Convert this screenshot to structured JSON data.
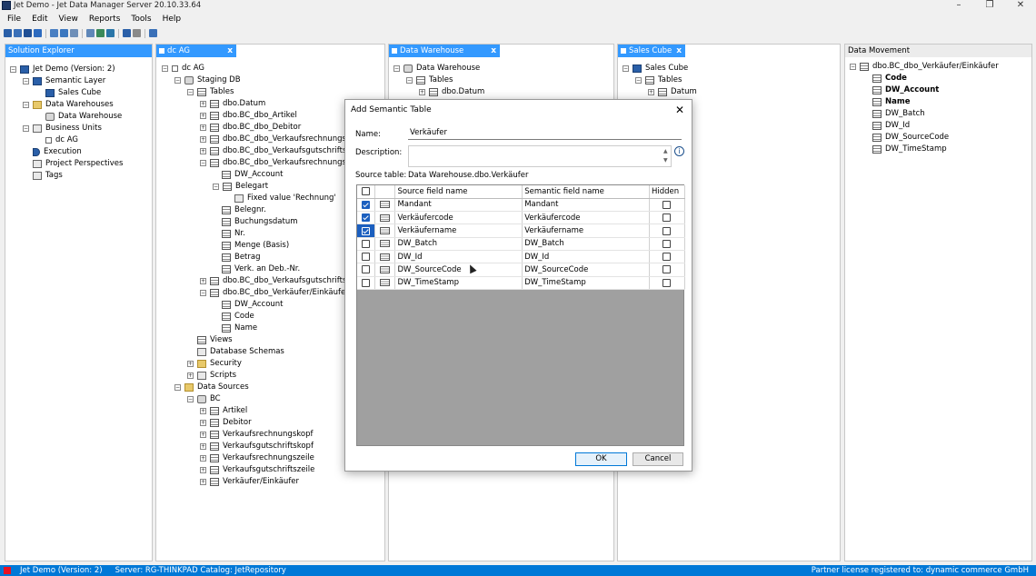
{
  "window": {
    "title": "Jet Demo - Jet Data Manager Server 20.10.33.64",
    "controls": [
      "–",
      "❐",
      "✕"
    ]
  },
  "menu": [
    "File",
    "Edit",
    "View",
    "Reports",
    "Tools",
    "Help"
  ],
  "panels": {
    "solution_explorer": {
      "title": "Solution Explorer",
      "items": [
        {
          "label": "Jet Demo (Version: 2)",
          "icon": "project-icon"
        },
        {
          "label": "Semantic Layer",
          "icon": "semantic-icon"
        },
        {
          "label": "Sales Cube",
          "icon": "cube-icon"
        },
        {
          "label": "Data Warehouses",
          "icon": "folder-icon"
        },
        {
          "label": "Data Warehouse",
          "icon": "warehouse-icon"
        },
        {
          "label": "Business Units",
          "icon": "business-icon"
        },
        {
          "label": "dc AG",
          "icon": "unit-icon"
        },
        {
          "label": "Execution",
          "icon": "execution-icon"
        },
        {
          "label": "Project Perspectives",
          "icon": "perspective-icon"
        },
        {
          "label": "Tags",
          "icon": "tag-icon"
        }
      ]
    },
    "dc_ag": {
      "title": "dc AG",
      "items": [
        "dc AG",
        "Staging DB",
        "Tables",
        "dbo.Datum",
        "dbo.BC_dbo_Artikel",
        "dbo.BC_dbo_Debitor",
        "dbo.BC_dbo_Verkaufsrechnungskopf",
        "dbo.BC_dbo_Verkaufsgutschriftskopf",
        "dbo.BC_dbo_Verkaufsrechnungszeile",
        "DW_Account",
        "Belegart",
        "Fixed value 'Rechnung'",
        "Belegnr.",
        "Buchungsdatum",
        "Nr.",
        "Menge (Basis)",
        "Betrag",
        "Verk. an Deb.-Nr.",
        "dbo.BC_dbo_Verkaufsgutschriftszeile",
        "dbo.BC_dbo_Verkäufer/Einkäufer*",
        "DW_Account",
        "Code",
        "Name",
        "Views",
        "Database Schemas",
        "Security",
        "Scripts",
        "Data Sources",
        "BC",
        "Artikel",
        "Debitor",
        "Verkaufsrechnungskopf",
        "Verkaufsgutschriftskopf",
        "Verkaufsrechnungszeile",
        "Verkaufsgutschriftszeile",
        "Verkäufer/Einkäufer"
      ]
    },
    "data_warehouse": {
      "title": "Data Warehouse",
      "items": [
        "Data Warehouse",
        "Tables",
        "dbo.Datum"
      ]
    },
    "sales_cube": {
      "title": "Sales Cube",
      "items": [
        "Sales Cube",
        "Tables",
        "Datum"
      ]
    },
    "data_movement": {
      "title": "Data Movement",
      "items": [
        "dbo.BC_dbo_Verkäufer/Einkäufer",
        "Code",
        "DW_Account",
        "Name",
        "DW_Batch",
        "DW_Id",
        "DW_SourceCode",
        "DW_TimeStamp"
      ]
    }
  },
  "dialog": {
    "title": "Add Semantic Table",
    "close": "✕",
    "name_label": "Name:",
    "name_value": "Verkäufer",
    "description_label": "Description:",
    "description_value": "",
    "source_label": "Source table:",
    "source_value": "Data Warehouse.dbo.Verkäufer",
    "columns": [
      "Source field name",
      "Semantic field name",
      "Hidden"
    ],
    "rows": [
      {
        "source": "Mandant",
        "semantic": "Mandant",
        "checked": true,
        "hidden": false
      },
      {
        "source": "Verkäufercode",
        "semantic": "Verkäufercode",
        "checked": true,
        "hidden": false
      },
      {
        "source": "Verkäufername",
        "semantic": "Verkäufername",
        "checked": true,
        "hidden": false
      },
      {
        "source": "DW_Batch",
        "semantic": "DW_Batch",
        "checked": false,
        "hidden": false
      },
      {
        "source": "DW_Id",
        "semantic": "DW_Id",
        "checked": false,
        "hidden": false
      },
      {
        "source": "DW_SourceCode",
        "semantic": "DW_SourceCode",
        "checked": false,
        "hidden": false
      },
      {
        "source": "DW_TimeStamp",
        "semantic": "DW_TimeStamp",
        "checked": false,
        "hidden": false
      }
    ],
    "ok": "OK",
    "cancel": "Cancel"
  },
  "status": {
    "project": "Jet Demo (Version: 2)",
    "server": "Server: RG-THINKPAD Catalog: JetRepository",
    "license": "Partner license registered to: dynamic commerce GmbH"
  },
  "colors": {
    "accent": "#3399ff",
    "status": "#0078d7",
    "selected": "#1b5fbf"
  }
}
